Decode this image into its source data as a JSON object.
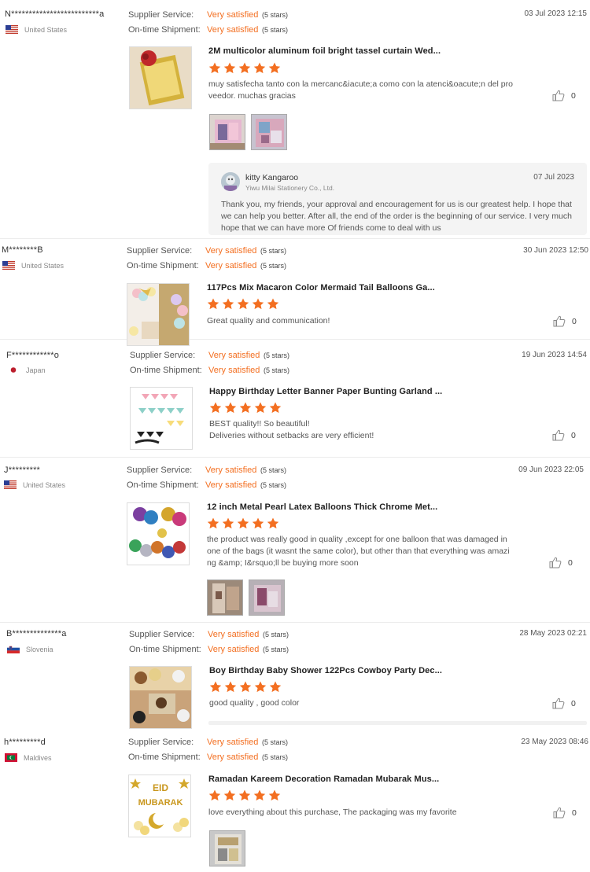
{
  "labels": {
    "supplier_service": "Supplier Service:",
    "ontime_shipment": "On-time Shipment:"
  },
  "colors": {
    "accent": "#f36f21",
    "star": "#f36f21"
  },
  "reviews": [
    {
      "buyer": "N*************************a",
      "country": "United States",
      "flag": "us-flag",
      "supplier_service": "Very satisfied",
      "supplier_stars": "(5 stars)",
      "ontime_shipment": "Very satisfied",
      "ontime_stars": "(5 stars)",
      "date": "03 Jul 2023 12:15",
      "product_title": "2M multicolor aluminum foil bright tassel curtain Wed...",
      "rating": 5,
      "text": "muy satisfecha tanto con la mercanc&iacute;a como con la atenci&oacute;n del proveedor. muchas gracias",
      "likes": "0",
      "photos": 2,
      "reply": {
        "name": "kitty Kangaroo",
        "company": "Yiwu Milai Stationery Co., Ltd.",
        "date": "07 Jul 2023",
        "text": "Thank you, my friends, your approval and encouragement for us is our greatest help. I hope that we can help you better. After all, the end of the order is the beginning of our service. I very much hope that we can have more Of friends come to deal with us"
      }
    },
    {
      "buyer": "M********B",
      "country": "United States",
      "flag": "us-flag",
      "supplier_service": "Very satisfied",
      "supplier_stars": "(5 stars)",
      "ontime_shipment": "Very satisfied",
      "ontime_stars": "(5 stars)",
      "date": "30 Jun 2023 12:50",
      "product_title": "117Pcs Mix Macaron Color Mermaid Tail Balloons Ga...",
      "rating": 5,
      "text": "Great quality and communication!",
      "likes": "0",
      "photos": 0
    },
    {
      "buyer": "F************o",
      "country": "Japan",
      "flag": "japan-flag",
      "supplier_service": "Very satisfied",
      "supplier_stars": "(5 stars)",
      "ontime_shipment": "Very satisfied",
      "ontime_stars": "(5 stars)",
      "date": "19 Jun 2023 14:54",
      "product_title": "Happy Birthday Letter Banner Paper Bunting Garland ...",
      "rating": 5,
      "text_lines": [
        "BEST quality!! So beautiful!",
        "Deliveries without setbacks are very efficient!"
      ],
      "likes": "0",
      "photos": 0
    },
    {
      "buyer": "J*********",
      "country": "United States",
      "flag": "us-flag",
      "supplier_service": "Very satisfied",
      "supplier_stars": "(5 stars)",
      "ontime_shipment": "Very satisfied",
      "ontime_stars": "(5 stars)",
      "date": "09 Jun 2023 22:05",
      "product_title": "12 inch Metal Pearl Latex Balloons Thick Chrome Met...",
      "rating": 5,
      "text": "the product was really good in quality ,except for one balloon that was damaged in one of the bags (it wasnt the same color), but other than that everything was amazing &amp; I&rsquo;ll be buying more soon",
      "likes": "0",
      "photos": 2
    },
    {
      "buyer": "B**************a",
      "country": "Slovenia",
      "flag": "slovenia-flag",
      "supplier_service": "Very satisfied",
      "supplier_stars": "(5 stars)",
      "ontime_shipment": "Very satisfied",
      "ontime_stars": "(5 stars)",
      "date": "28 May 2023 02:21",
      "product_title": "Boy Birthday Baby Shower 122Pcs Cowboy Party Dec...",
      "rating": 5,
      "text": "good quality , good color",
      "likes": "0",
      "photos": 0
    },
    {
      "buyer": "h*********d",
      "country": "Maldives",
      "flag": "maldives-flag",
      "supplier_service": "Very satisfied",
      "supplier_stars": "(5 stars)",
      "ontime_shipment": "Very satisfied",
      "ontime_stars": "(5 stars)",
      "date": "23 May 2023 08:46",
      "product_title": "Ramadan Kareem Decoration Ramadan Mubarak Mus...",
      "rating": 5,
      "text": "love everything about this purchase, The packaging was my favorite",
      "likes": "0",
      "photos": 1,
      "thumb_text": [
        "EID",
        "MUBARAK"
      ]
    }
  ]
}
